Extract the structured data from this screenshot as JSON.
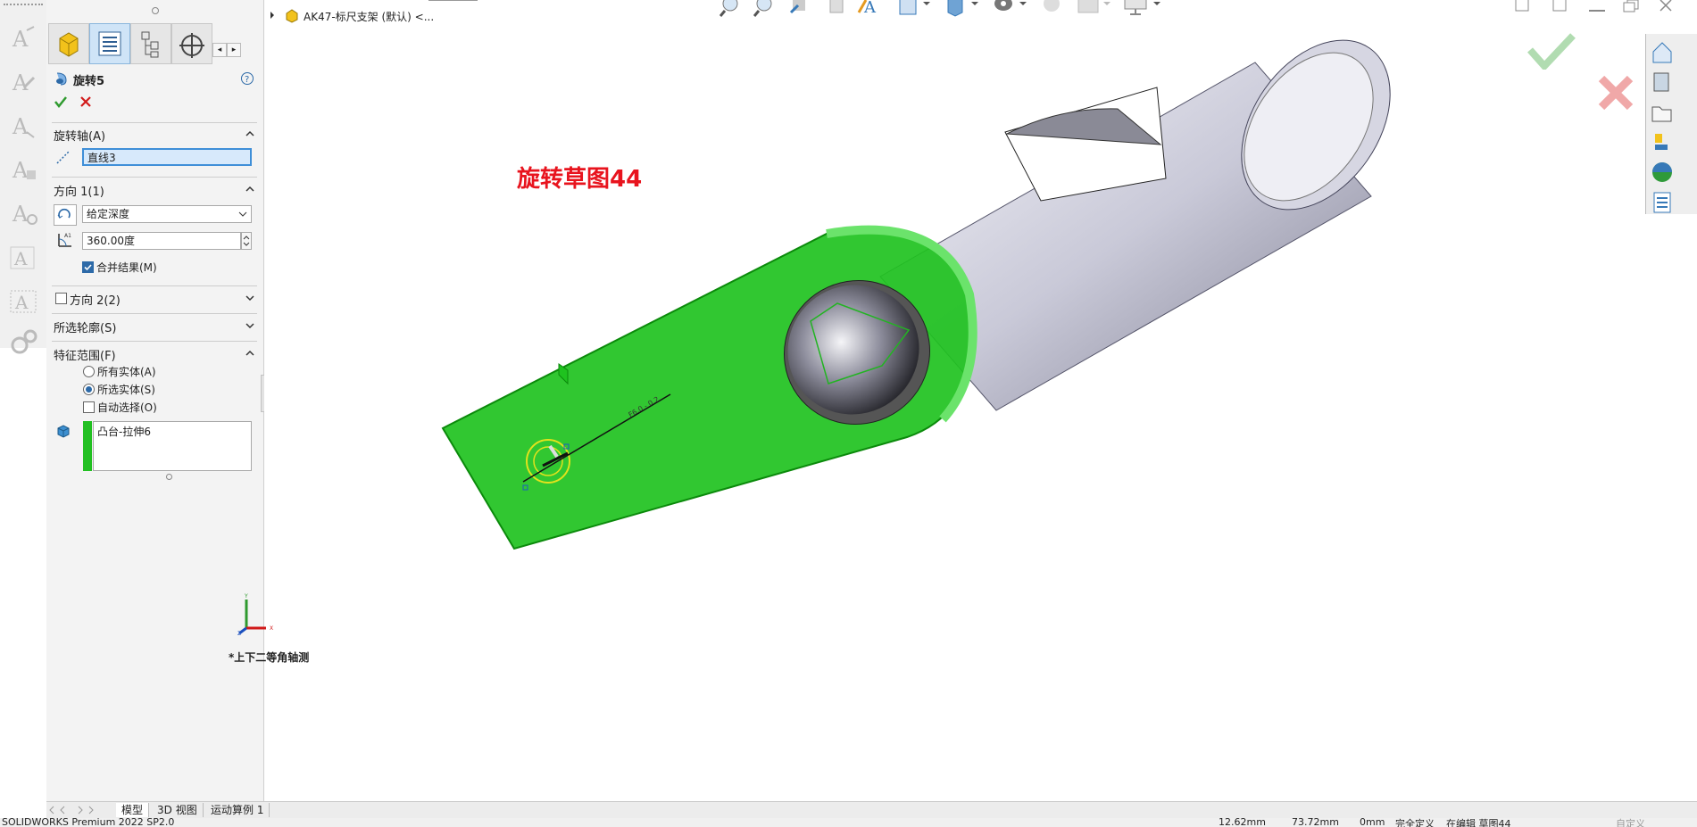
{
  "pm": {
    "feature_title": "旋转5",
    "axis_section": "旋转轴(A)",
    "axis_value": "直线3",
    "dir1_section": "方向 1(1)",
    "dir1_type": "给定深度",
    "dir1_angle": "360.00度",
    "merge_label": "合并结果(M)",
    "dir2_section": "方向 2(2)",
    "contours_section": "所选轮廓(S)",
    "scope_section": "特征范围(F)",
    "scope_options": [
      "所有实体(A)",
      "所选实体(S)",
      "自动选择(O)"
    ],
    "body_item": "凸台-拉伸6"
  },
  "viewport": {
    "doc_title": "AK47-标尺支架 (默认) <...",
    "annotation": "旋转草图44",
    "view_label": "*上下二等角轴测",
    "sketch_dim": "F6.0 - 0.2"
  },
  "bottom_tabs": [
    "模型",
    "3D 视图",
    "运动算例 1"
  ],
  "status": {
    "app": "SOLIDWORKS Premium 2022 SP2.0",
    "x": "12.62mm",
    "y": "73.72mm",
    "z": "0mm",
    "state": "完全定义",
    "editing": "在编辑 草图44",
    "custom": "自定义"
  },
  "colors": {
    "part_green": "#1fc21f",
    "annotation_red": "#e8141e",
    "accept_green": "#3aa13a",
    "cancel_red": "#d11a1a"
  }
}
